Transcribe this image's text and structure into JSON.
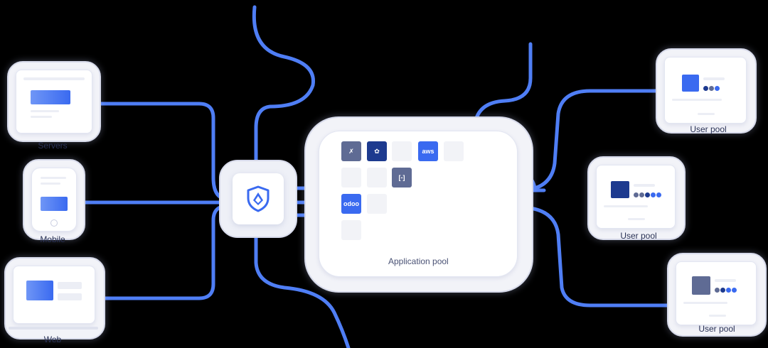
{
  "sources": [
    {
      "label": "Servers"
    },
    {
      "label": "Mobile"
    },
    {
      "label": "Web"
    }
  ],
  "application_pool": {
    "label": "Application pool",
    "apps": [
      {
        "name": "kong",
        "text": "✗",
        "color": "#5f6b94"
      },
      {
        "name": "huawei",
        "text": "✿",
        "color": "#1d3a8f"
      },
      {
        "name": "aws",
        "text": "aws",
        "color": "#3a6af0"
      },
      {
        "name": "alibaba-cloud",
        "text": "[-]",
        "color": "#5f6b94"
      },
      {
        "name": "odoo",
        "text": "odoo",
        "color": "#3a6af0"
      }
    ]
  },
  "user_pools": [
    {
      "label": "User pool",
      "color": "#3a6af0"
    },
    {
      "label": "User pool",
      "color": "#1d3a8f"
    },
    {
      "label": "User pool",
      "color": "#5f6b94"
    }
  ],
  "colors": {
    "line": "#4f7ef5",
    "card_bg": "#f2f3f8",
    "card_border": "#d7daea"
  }
}
